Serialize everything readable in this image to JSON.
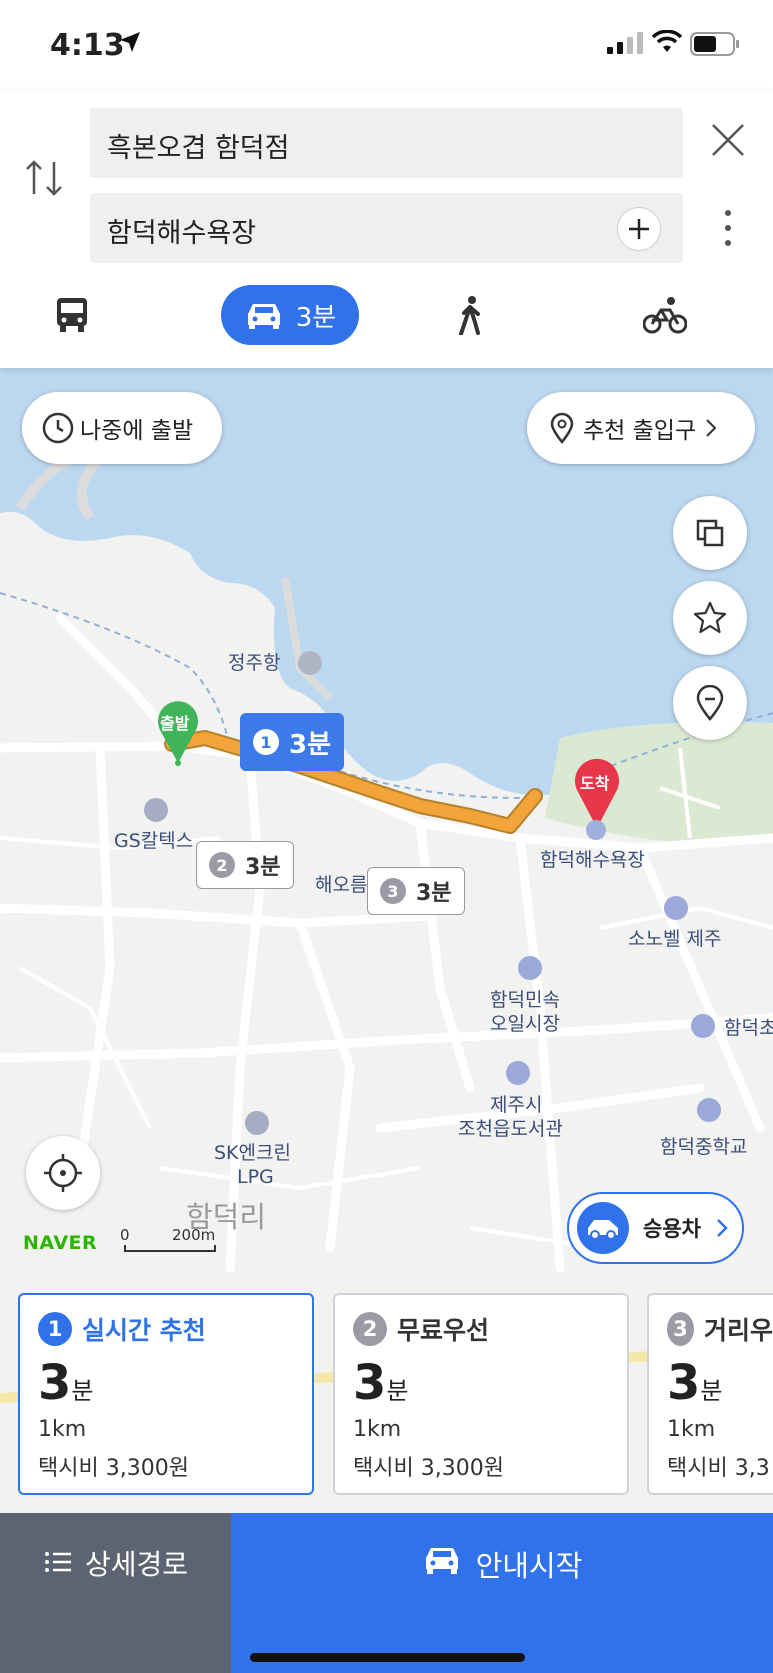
{
  "status_bar": {
    "time": "4:13"
  },
  "search": {
    "origin": "흑본오겹 함덕점",
    "destination": "함덕해수욕장"
  },
  "modes": {
    "car_eta": "3분"
  },
  "map": {
    "depart_later": "나중에 출발",
    "recommended_entrance": "추천 출입구",
    "vehicle_type": "승용차",
    "start_marker": "출발",
    "end_marker": "도착",
    "scale": {
      "zero": "0",
      "distance": "200m"
    },
    "brand": "NAVER",
    "places": {
      "port": "정주항",
      "gas_station": "GS칼텍스",
      "haeoreum": "해오름",
      "beach": "함덕해수욕장",
      "sonobell": "소노벨 제주",
      "market_line1": "함덕민속",
      "market_line2": "오일시장",
      "library_line1": "제주시",
      "library_line2": "조천읍도서관",
      "lpg_line1": "SK엔크린",
      "lpg_line2": "LPG",
      "middle_school": "함덕중학교",
      "hamdeok_cho": "함덕초",
      "district": "함덕리"
    },
    "route_tags": [
      {
        "num": "1",
        "eta": "3분"
      },
      {
        "num": "2",
        "eta": "3분"
      },
      {
        "num": "3",
        "eta": "3분"
      }
    ]
  },
  "routes": [
    {
      "num": "1",
      "name": "실시간 추천",
      "eta_value": "3",
      "eta_unit": "분",
      "distance": "1km",
      "fare": "택시비 3,300원"
    },
    {
      "num": "2",
      "name": "무료우선",
      "eta_value": "3",
      "eta_unit": "분",
      "distance": "1km",
      "fare": "택시비 3,300원"
    },
    {
      "num": "3",
      "name": "거리우",
      "eta_value": "3",
      "eta_unit": "분",
      "distance": "1km",
      "fare": "택시비 3,3"
    }
  ],
  "bottom": {
    "details_label": "상세경로",
    "start_label": "안내시작"
  },
  "colors": {
    "accent": "#2f72ea",
    "route": "#f2a33a",
    "start_marker": "#3fb45a",
    "end_marker": "#e8364a",
    "water": "#bcd7f0"
  }
}
